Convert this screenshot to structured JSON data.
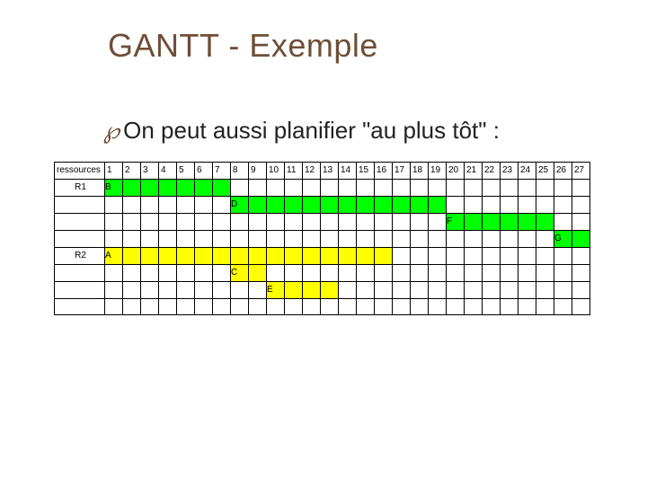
{
  "title": "GANTT - Exemple",
  "bullet_text": "On peut aussi planifier \"au plus tôt\" :",
  "chart_data": {
    "type": "table",
    "header_label": "ressources",
    "time_columns": [
      "1",
      "2",
      "3",
      "4",
      "5",
      "6",
      "7",
      "8",
      "9",
      "10",
      "11",
      "12",
      "13",
      "14",
      "15",
      "16",
      "17",
      "18",
      "19",
      "20",
      "21",
      "22",
      "23",
      "24",
      "25",
      "26",
      "27"
    ],
    "resources": [
      "R1",
      "R2"
    ],
    "bars": [
      {
        "row_index": 1,
        "label": "B",
        "start": 1,
        "end": 7,
        "color": "green"
      },
      {
        "row_index": 2,
        "label": "D",
        "start": 8,
        "end": 19,
        "color": "green"
      },
      {
        "row_index": 3,
        "label": "F",
        "start": 20,
        "end": 25,
        "color": "green"
      },
      {
        "row_index": 4,
        "label": "G",
        "start": 26,
        "end": 27,
        "color": "green"
      },
      {
        "row_index": 5,
        "label": "A",
        "start": 1,
        "end": 16,
        "color": "yellow"
      },
      {
        "row_index": 6,
        "label": "C",
        "start": 8,
        "end": 9,
        "color": "yellow"
      },
      {
        "row_index": 7,
        "label": "E",
        "start": 10,
        "end": 13,
        "color": "yellow"
      }
    ],
    "n_rows_below_header": 8
  }
}
